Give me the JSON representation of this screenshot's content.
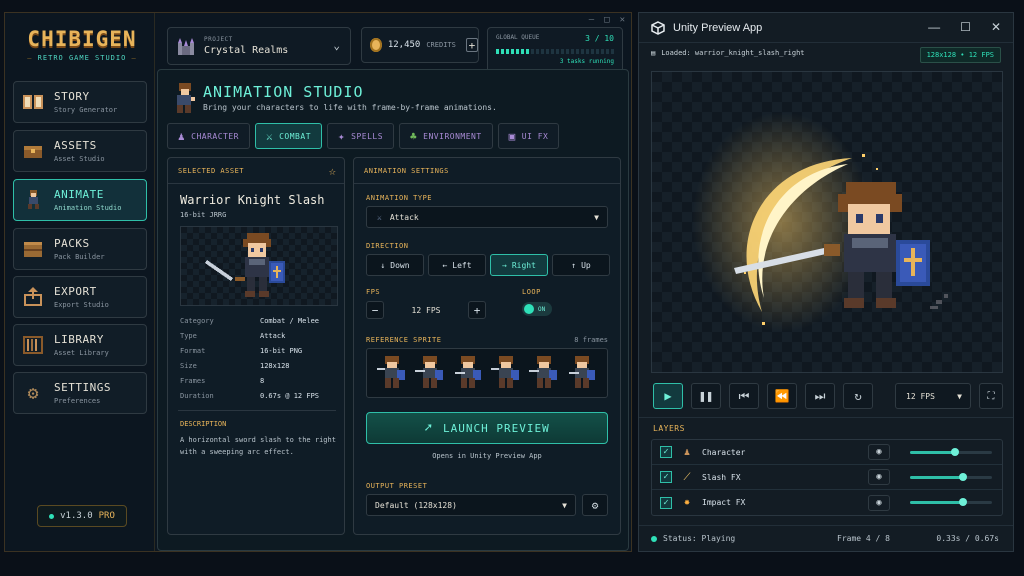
{
  "app": {
    "logo_title": "CHIBIGEN",
    "logo_subtitle": "RETRO GAME STUDIO",
    "version": "v1.3.0",
    "version_tier": "PRO"
  },
  "sidebar": {
    "items": [
      {
        "label": "STORY",
        "sub": "Story Generator",
        "icon": "book-icon"
      },
      {
        "label": "ASSETS",
        "sub": "Asset Studio",
        "icon": "chest-icon"
      },
      {
        "label": "ANIMATE",
        "sub": "Animation Studio",
        "icon": "runner-icon",
        "active": true
      },
      {
        "label": "PACKS",
        "sub": "Pack Builder",
        "icon": "crate-icon"
      },
      {
        "label": "EXPORT",
        "sub": "Export Studio",
        "icon": "export-icon"
      },
      {
        "label": "LIBRARY",
        "sub": "Asset Library",
        "icon": "bookshelf-icon"
      },
      {
        "label": "SETTINGS",
        "sub": "Preferences",
        "icon": "gear-icon"
      }
    ]
  },
  "header": {
    "project_label": "PROJECT",
    "project_name": "Crystal Realms",
    "credits_value": "12,450",
    "credits_label": "CREDITS",
    "queue_label": "GLOBAL QUEUE",
    "queue_count": "3 / 10",
    "queue_progress": 0.3,
    "queue_status": "3 tasks running"
  },
  "studio": {
    "title": "ANIMATION STUDIO",
    "subtitle": "Bring your characters to life with frame-by-frame animations.",
    "tabs": [
      {
        "label": "CHARACTER",
        "icon": "person-icon"
      },
      {
        "label": "COMBAT",
        "icon": "sword-icon",
        "active": true
      },
      {
        "label": "SPELLS",
        "icon": "sparkle-icon"
      },
      {
        "label": "ENVIRONMENT",
        "icon": "tree-icon"
      },
      {
        "label": "UI FX",
        "icon": "window-icon"
      }
    ]
  },
  "asset": {
    "header": "SELECTED ASSET",
    "name": "Warrior Knight Slash",
    "tag": "16-bit JRRG",
    "props": [
      {
        "k": "Category",
        "v": "Combat / Melee"
      },
      {
        "k": "Type",
        "v": "Attack"
      },
      {
        "k": "Format",
        "v": "16-bit PNG"
      },
      {
        "k": "Size",
        "v": "128x128"
      },
      {
        "k": "Frames",
        "v": "8"
      },
      {
        "k": "Duration",
        "v": "0.67s @ 12 FPS"
      }
    ],
    "desc_header": "DESCRIPTION",
    "description": "A horizontal sword slash to the right with a sweeping arc effect."
  },
  "settings": {
    "header": "ANIMATION SETTINGS",
    "type_label": "ANIMATION TYPE",
    "type_value": "Attack",
    "direction_label": "DIRECTION",
    "directions": [
      {
        "label": "Down",
        "arrow": "↓"
      },
      {
        "label": "Left",
        "arrow": "←"
      },
      {
        "label": "Right",
        "arrow": "→",
        "active": true
      },
      {
        "label": "Up",
        "arrow": "↑"
      }
    ],
    "fps_label": "FPS",
    "fps_value": "12 FPS",
    "loop_label": "LOOP",
    "loop_value": "ON",
    "ref_label": "REFERENCE SPRITE",
    "ref_count": "8 frames",
    "launch_label": "LAUNCH PREVIEW",
    "launch_note": "Opens in Unity Preview App",
    "preset_label": "OUTPUT PRESET",
    "preset_value": "Default (128x128)"
  },
  "preview": {
    "title": "Unity Preview App",
    "loaded": "Loaded: warrior_knight_slash_right",
    "badge": "128x128 • 12 FPS",
    "fps_value": "12 FPS",
    "layers_header": "LAYERS",
    "layers": [
      {
        "name": "Character",
        "icon": "person-icon",
        "opacity": 0.55
      },
      {
        "name": "Slash FX",
        "icon": "slash-icon",
        "opacity": 0.65
      },
      {
        "name": "Impact FX",
        "icon": "burst-icon",
        "opacity": 0.65
      }
    ],
    "status": "Status: Playing",
    "frame": "Frame 4 / 8",
    "time": "0.33s / 0.67s"
  },
  "colors": {
    "accent": "#2fe0b8",
    "gold": "#e8b45a",
    "purple": "#a98bd6"
  }
}
